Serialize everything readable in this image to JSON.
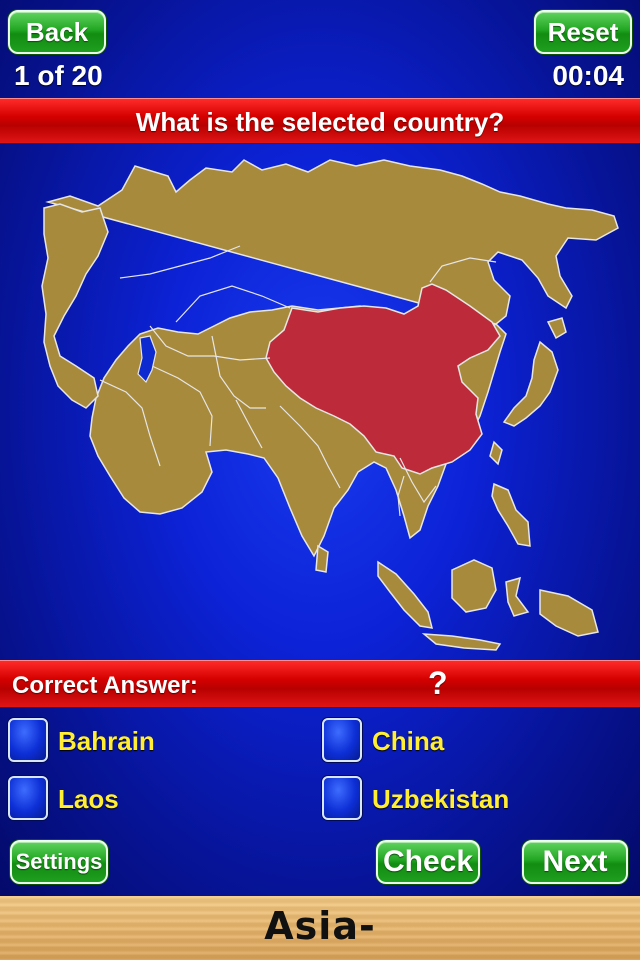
{
  "header": {
    "back_label": "Back",
    "reset_label": "Reset",
    "progress": "1 of 20",
    "timer": "00:04"
  },
  "question": {
    "text": "What is the selected country?"
  },
  "map": {
    "region": "Asia",
    "selected_country": "China",
    "land_color": "#a88a3c",
    "selected_color": "#bd2b3a",
    "border_color": "#e6e6e6"
  },
  "answer": {
    "label": "Correct Answer:",
    "value": "?"
  },
  "choices": [
    {
      "label": "Bahrain"
    },
    {
      "label": "China"
    },
    {
      "label": "Laos"
    },
    {
      "label": "Uzbekistan"
    }
  ],
  "footer": {
    "settings_label": "Settings",
    "check_label": "Check",
    "next_label": "Next",
    "title": "Asia-"
  },
  "colors": {
    "button_green": "#22a622",
    "banner_red": "#d40000",
    "choice_text": "#ffee33",
    "background_blue": "#0c22d6"
  }
}
